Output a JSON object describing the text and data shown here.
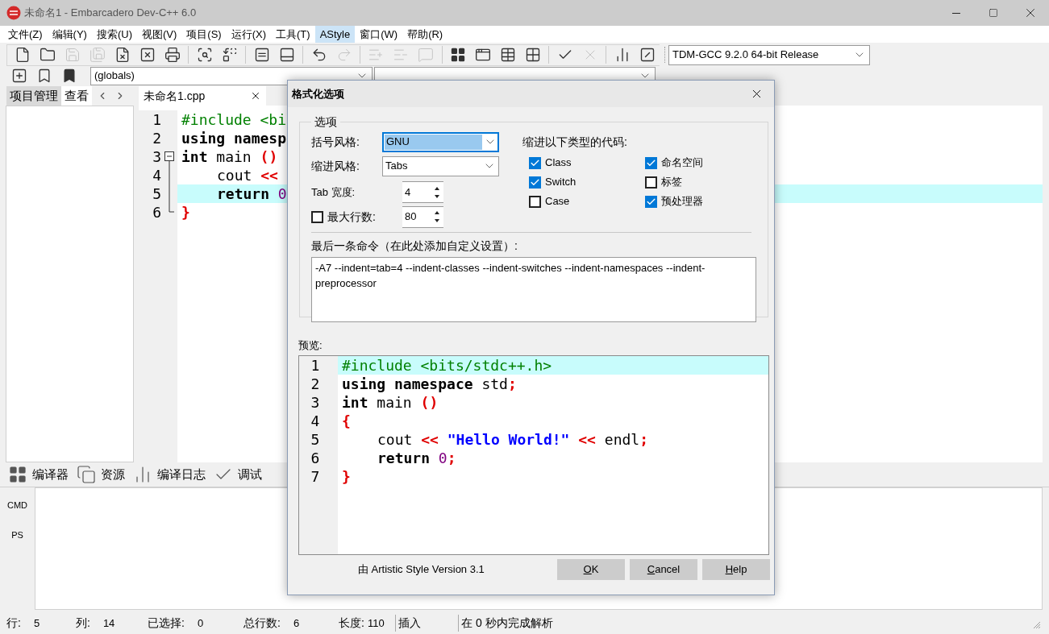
{
  "window": {
    "title": "未命名1 - Embarcadero Dev-C++ 6.0"
  },
  "menu": [
    {
      "label": "文件(Z)",
      "selected": false
    },
    {
      "label": "编辑(Y)",
      "selected": false
    },
    {
      "label": "搜索(U)",
      "selected": false
    },
    {
      "label": "视图(V)",
      "selected": false
    },
    {
      "label": "项目(S)",
      "selected": false
    },
    {
      "label": "运行(X)",
      "selected": false
    },
    {
      "label": "工具(T)",
      "selected": false
    },
    {
      "label": "AStyle",
      "selected": true
    },
    {
      "label": "窗口(W)",
      "selected": false
    },
    {
      "label": "帮助(R)",
      "selected": false
    }
  ],
  "toolbar_1": [
    {
      "kind": "new-file",
      "disabled": false
    },
    {
      "kind": "open",
      "disabled": false
    },
    {
      "kind": "save",
      "disabled": true
    },
    {
      "kind": "save-all",
      "disabled": true
    },
    {
      "kind": "close",
      "disabled": false
    },
    {
      "kind": "close-all",
      "disabled": false
    },
    {
      "kind": "print",
      "disabled": false
    },
    {
      "kind": "separator"
    },
    {
      "kind": "find",
      "disabled": false
    },
    {
      "kind": "replace",
      "disabled": false
    },
    {
      "kind": "separator"
    },
    {
      "kind": "equal",
      "disabled": false
    },
    {
      "kind": "panel",
      "disabled": false
    },
    {
      "kind": "separator"
    },
    {
      "kind": "undo",
      "disabled": false
    },
    {
      "kind": "redo",
      "disabled": true
    },
    {
      "kind": "separator"
    },
    {
      "kind": "indent",
      "disabled": true
    },
    {
      "kind": "unindent",
      "disabled": true
    },
    {
      "kind": "comment",
      "disabled": true
    },
    {
      "kind": "separator"
    },
    {
      "kind": "grid",
      "disabled": false
    },
    {
      "kind": "window",
      "disabled": false
    },
    {
      "kind": "table",
      "disabled": false
    },
    {
      "kind": "grid-outline",
      "disabled": false
    },
    {
      "kind": "separator"
    },
    {
      "kind": "check",
      "disabled": false
    },
    {
      "kind": "cross",
      "disabled": true
    },
    {
      "kind": "separator"
    },
    {
      "kind": "chart",
      "disabled": false
    },
    {
      "kind": "chart-cross",
      "disabled": false
    }
  ],
  "compiler_select": {
    "value": "TDM-GCC 9.2.0 64-bit Release"
  },
  "toolbar_2": [
    {
      "kind": "add-bookmark"
    },
    {
      "kind": "bookmark"
    },
    {
      "kind": "bookmark-filled"
    }
  ],
  "scope_select": {
    "value": "(globals)"
  },
  "left_tabs": [
    {
      "label": "项目管理",
      "selected": true
    },
    {
      "label": "查看",
      "selected": false
    }
  ],
  "editor_tab": {
    "label": "未命名1.cpp"
  },
  "editor": {
    "lines": [
      {
        "number": "1",
        "highlighted": false,
        "kind": "plain",
        "indent": false,
        "tokens": [
          {
            "text": "#include <bi",
            "kind": "preproc"
          }
        ]
      },
      {
        "number": "2",
        "highlighted": false,
        "kind": "plain",
        "indent": false,
        "tokens": [
          {
            "text": "using namesp",
            "kind": "keyword"
          }
        ]
      },
      {
        "number": "3",
        "highlighted": false,
        "kind": "fold-start",
        "indent": false,
        "tokens": [
          {
            "text": "int",
            "kind": "keyword"
          },
          {
            "text": " main ",
            "kind": "plain"
          },
          {
            "text": "()",
            "kind": "symbol"
          }
        ]
      },
      {
        "number": "4",
        "highlighted": false,
        "kind": "fold-body",
        "indent": true,
        "tokens": [
          {
            "text": "cout ",
            "kind": "plain"
          },
          {
            "text": "<<",
            "kind": "symbol"
          }
        ]
      },
      {
        "number": "5",
        "highlighted": true,
        "kind": "fold-body",
        "indent": true,
        "tokens": [
          {
            "text": "return ",
            "kind": "keyword"
          },
          {
            "text": "0",
            "kind": "number"
          }
        ]
      },
      {
        "number": "6",
        "highlighted": false,
        "kind": "fold-end",
        "indent": false,
        "tokens": [
          {
            "text": "}",
            "kind": "symbol"
          }
        ]
      }
    ]
  },
  "bottom_tabs": [
    {
      "label": "编译器",
      "kind": "compiler"
    },
    {
      "label": "资源",
      "kind": "resources"
    },
    {
      "label": "编译日志",
      "kind": "log"
    },
    {
      "label": "调试",
      "kind": "debug"
    }
  ],
  "output_labels": [
    "CMD",
    "PS"
  ],
  "status_bar": [
    {
      "label": "行:",
      "value": "5"
    },
    {
      "label": "列:",
      "value": "14"
    },
    {
      "label": "已选择:",
      "value": "0"
    },
    {
      "label": "总行数:",
      "value": "6"
    },
    {
      "label": "长度:",
      "value": "110"
    },
    {
      "label": "插入"
    },
    {
      "label": "在 0 秒内完成解析"
    }
  ],
  "dialog": {
    "title": "格式化选项",
    "group_label": "选项",
    "bracket_style": {
      "label": "括号风格:",
      "value": "GNU",
      "focused": true
    },
    "indent_style": {
      "label": "缩进风格:",
      "value": "Tabs",
      "focused": false
    },
    "tab_width": {
      "label": "Tab 宽度:",
      "value": "4"
    },
    "max_line": {
      "label": "最大行数:",
      "checked": false,
      "value": "80"
    },
    "indent_heading": "缩进以下类型的代码:",
    "indent_options": [
      {
        "label": "Class",
        "checked": true
      },
      {
        "label": "命名空间",
        "checked": true
      },
      {
        "label": "Switch",
        "checked": true
      },
      {
        "label": "标签",
        "checked": false
      },
      {
        "label": "Case",
        "checked": false
      },
      {
        "label": "预处理器",
        "checked": true
      }
    ],
    "command_label": "最后一条命令（在此处添加自定义设置）:",
    "command": "-A7 --indent=tab=4 --indent-classes --indent-switches --indent-namespaces --indent-preprocessor",
    "preview_label": "预览:",
    "preview": {
      "lines": [
        {
          "number": "1",
          "highlighted": true,
          "indent": false,
          "tokens": [
            {
              "text": "#include <bits/stdc++.h>",
              "kind": "preproc"
            }
          ]
        },
        {
          "number": "2",
          "highlighted": false,
          "indent": false,
          "tokens": [
            {
              "text": "using namespace",
              "kind": "keyword"
            },
            {
              "text": " std",
              "kind": "plain"
            },
            {
              "text": ";",
              "kind": "symbol"
            }
          ]
        },
        {
          "number": "3",
          "highlighted": false,
          "indent": false,
          "tokens": [
            {
              "text": "int",
              "kind": "keyword"
            },
            {
              "text": " main ",
              "kind": "plain"
            },
            {
              "text": "()",
              "kind": "symbol"
            }
          ]
        },
        {
          "number": "4",
          "highlighted": false,
          "indent": false,
          "tokens": [
            {
              "text": "{",
              "kind": "symbol"
            }
          ]
        },
        {
          "number": "5",
          "highlighted": false,
          "indent": true,
          "tokens": [
            {
              "text": "cout ",
              "kind": "plain"
            },
            {
              "text": "<<",
              "kind": "symbol"
            },
            {
              "text": " \"Hello World!\"",
              "kind": "string"
            },
            {
              "text": " <<",
              "kind": "symbol"
            },
            {
              "text": " endl",
              "kind": "plain"
            },
            {
              "text": ";",
              "kind": "symbol"
            }
          ]
        },
        {
          "number": "6",
          "highlighted": false,
          "indent": true,
          "tokens": [
            {
              "text": "return ",
              "kind": "keyword"
            },
            {
              "text": "0",
              "kind": "number"
            },
            {
              "text": ";",
              "kind": "symbol"
            }
          ]
        },
        {
          "number": "7",
          "highlighted": false,
          "indent": false,
          "tokens": [
            {
              "text": "}",
              "kind": "symbol"
            }
          ]
        }
      ]
    },
    "version": "由 Artistic Style Version 3.1",
    "buttons": [
      "OK",
      "Cancel",
      "Help"
    ]
  }
}
